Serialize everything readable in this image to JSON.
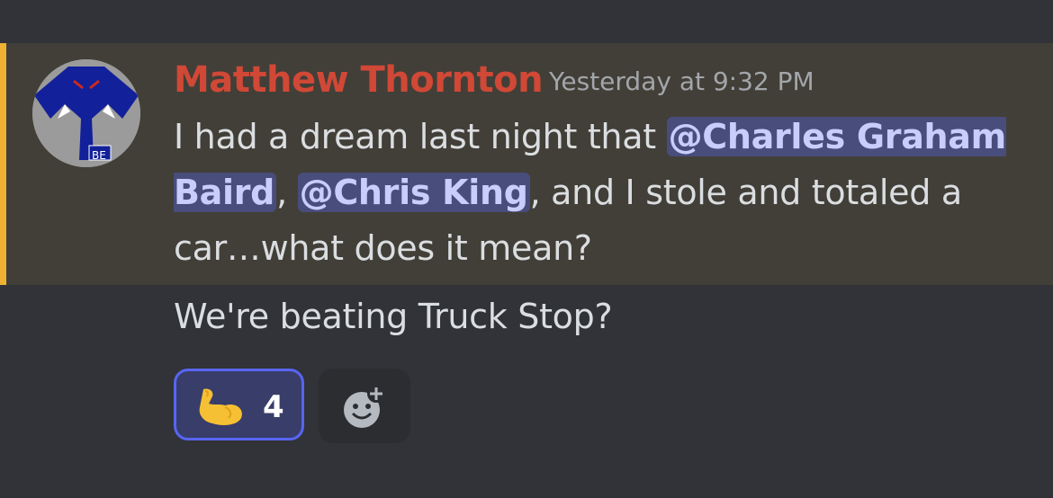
{
  "message": {
    "author": "Matthew Thornton",
    "timestamp": "Yesterday at 9:32 PM",
    "avatar_label": "BE",
    "content": {
      "part1": "I had a dream last night that ",
      "mention1": "@Charles Graham Baird",
      "part2": ", ",
      "mention2": "@Chris King",
      "part3": ", and I stole and totaled a car…what does it mean?"
    },
    "highlight_color": "#f0b232",
    "author_color": "#d14836"
  },
  "followup": {
    "text": "We're beating Truck Stop?"
  },
  "reactions": [
    {
      "emoji": "flexed-biceps-icon",
      "count": "4"
    }
  ],
  "add_reaction": {
    "icon": "add-reaction-icon"
  }
}
